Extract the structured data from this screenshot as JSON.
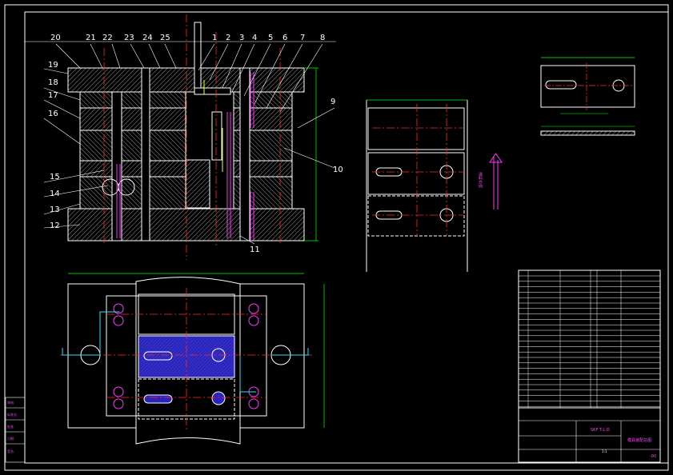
{
  "drawing": {
    "background": "#000000",
    "colors": {
      "outline": "#ffffff",
      "center": "#ff2a2a",
      "dimension": "#00ff00",
      "callout_text": "#ffffff",
      "leader": "#ff33ff",
      "hatch": "#ffffff",
      "highlight": "#2a24b8",
      "cyan": "#33e0ff",
      "yellow": "#ffff33"
    },
    "part_callouts": [
      "20",
      "21",
      "22",
      "23",
      "24",
      "25",
      "1",
      "2",
      "3",
      "4",
      "5",
      "6",
      "7",
      "8",
      "9",
      "10",
      "11",
      "12",
      "13",
      "14",
      "15",
      "16",
      "17",
      "18",
      "19"
    ],
    "strip_direction_note": "送料方向",
    "title_block": {
      "scale": "1:1",
      "drawing_no": "-00",
      "title": "模具装配总图",
      "material_note": "SKF T-L D"
    },
    "side_legend": [
      "审核",
      "标准化",
      "批准",
      "日期",
      "签名"
    ]
  }
}
